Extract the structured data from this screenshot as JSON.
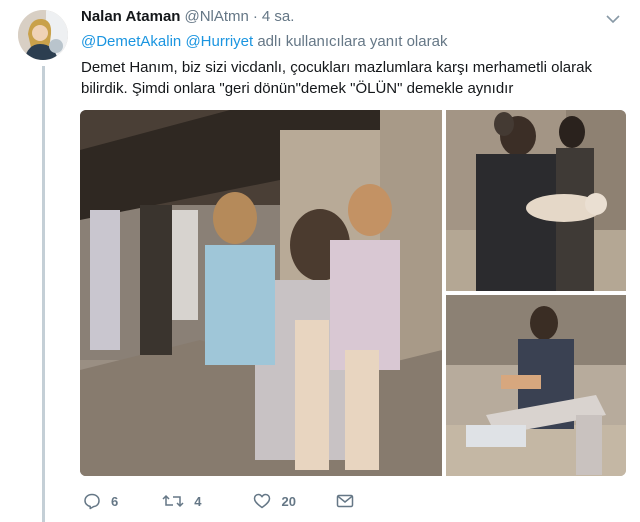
{
  "tweet": {
    "author_name": "Nalan Ataman",
    "author_handle": "@NlAtmn",
    "separator": "·",
    "timestamp": "4 sa.",
    "reply_context": {
      "mention_1": "@DemetAkalin",
      "mention_2": "@Hurriyet",
      "suffix": "adlı kullanıcılara yanıt olarak"
    },
    "text_line_1": "Demet Hanım, biz sizi vicdanlı, çocukları mazlumlara karşı merhametli olarak",
    "text_line_2": "bilirdik. Şimdi onlara \"geri dönün\"demek \"ÖLÜN\" demekle aynıdır",
    "media": {
      "photo_count": 3
    },
    "actions": {
      "reply_count": "6",
      "retweet_count": "4",
      "like_count": "20"
    }
  },
  "icons": {
    "caret": "chevron-down-icon",
    "reply": "reply-icon",
    "retweet": "retweet-icon",
    "like": "heart-icon",
    "message": "envelope-icon"
  },
  "colors": {
    "link": "#1b95e0",
    "secondary_text": "#657786",
    "primary_text": "#14171a",
    "thread_line": "#c4cfd6"
  }
}
